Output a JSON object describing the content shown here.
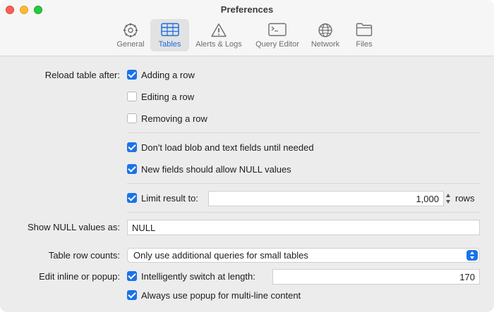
{
  "window": {
    "title": "Preferences"
  },
  "tabs": [
    {
      "label": "General",
      "icon": "gear-icon"
    },
    {
      "label": "Tables",
      "icon": "table-icon",
      "selected": true
    },
    {
      "label": "Alerts & Logs",
      "icon": "warning-icon"
    },
    {
      "label": "Query Editor",
      "icon": "terminal-icon"
    },
    {
      "label": "Network",
      "icon": "globe-icon"
    },
    {
      "label": "Files",
      "icon": "folder-icon"
    }
  ],
  "reload": {
    "label": "Reload table after:",
    "options": [
      {
        "label": "Adding a row",
        "checked": true
      },
      {
        "label": "Editing a row",
        "checked": false
      },
      {
        "label": "Removing a row",
        "checked": false
      }
    ]
  },
  "blob_option": {
    "label": "Don't load blob and text fields until needed",
    "checked": true
  },
  "null_fields_option": {
    "label": "New fields should allow NULL values",
    "checked": true
  },
  "limit": {
    "label": "Limit result to:",
    "checked": true,
    "value": "1,000",
    "unit": "rows"
  },
  "null_display": {
    "label": "Show NULL values as:",
    "value": "NULL"
  },
  "row_counts": {
    "label": "Table row counts:",
    "selected": "Only use additional queries for small tables"
  },
  "edit_inline": {
    "label": "Edit inline or popup:",
    "switch_option": {
      "label": "Intelligently switch at length:",
      "checked": true,
      "value": "170"
    },
    "multiline_option": {
      "label": "Always use popup for multi-line content",
      "checked": true
    }
  },
  "colors": {
    "accent": "#1a73e8",
    "selected_tab_text": "#1a6fe0"
  }
}
